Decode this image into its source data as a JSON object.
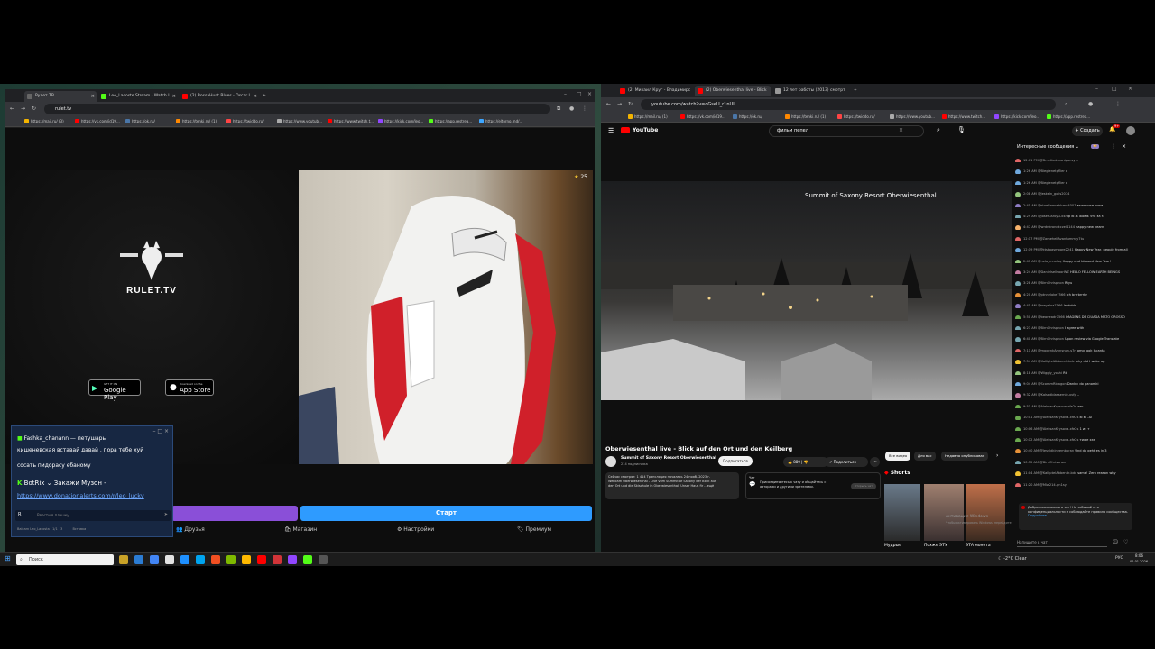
{
  "left_browser": {
    "tabs": [
      {
        "label": "Рулет ТВ",
        "active": true,
        "color": "#666"
      },
      {
        "label": "Leo_Lacostе Stream - Watch Li",
        "active": false,
        "color": "#53fc18"
      },
      {
        "label": "(2) BossaHunt Blues - Oscar I",
        "active": false,
        "color": "#ff0000"
      }
    ],
    "url": "rulet.tv",
    "bookmarks": [
      "https://mail.ru/ (3)",
      "https://vk.com/id19...",
      "https://ok.ru/",
      "https://tenki.ru/ (1)",
      "https://twiddo.ru/",
      "https://www.youtub...",
      "https://www.twitch.t...",
      "https://kick.com/leo...",
      "https://app.restrea...",
      "https://eltorno.md/..."
    ],
    "logo_text": "RULET.TV",
    "store_google": "Google Play",
    "store_google_small": "GET IT ON",
    "store_apple": "App Store",
    "store_apple_small": "Download on the",
    "video_badge": "25",
    "purple_input_placeholder": "",
    "start_button": "Старт",
    "bottom_nav": [
      "Друзья",
      "Магазин",
      "Настройки",
      "Премиум"
    ]
  },
  "chat_overlay": {
    "line1": "Fashka_chanann — петушары",
    "line2": "кишеневская вставай давай . пора тебе хуй",
    "line3": "сосать пидорасу ебаному",
    "bot_name": "BotRix",
    "bot_msg": "Закажи Музон -",
    "bot_link": "https://www.donationalerts.com/r/leo_lucky",
    "input_placeholder": "Ввести в плашку",
    "footer_user": "Balcarn Leo_Lacosta",
    "footer_count": "1/1",
    "footer_viewers": "3",
    "footer_right": "Вставка"
  },
  "right_browser": {
    "tabs": [
      {
        "label": "(2) Михаил Круг - Владимирс",
        "active": false,
        "color": "#ff0000"
      },
      {
        "label": "(2) Oberwiesenthal live - Blick",
        "active": true,
        "color": "#ff0000"
      },
      {
        "label": "12 лет работы (2013) смотрт",
        "active": false,
        "color": "#999"
      }
    ],
    "url": "youtube.com/watch?v=oGseU_r1nUI",
    "bookmarks": [
      "https://mail.ru/ (1)",
      "https://vk.com/id19...",
      "https://ok.ru/",
      "https://tenki.ru/ (1)",
      "https://twiddo.ru/",
      "https://www.youtub...",
      "https://www.twitch...",
      "https://kick.com/leo...",
      "https://app.restrea..."
    ],
    "yt_search": "фильм пепел",
    "create_label": "Создать",
    "notif_count": "9+",
    "video_title_overlay": "Summit of Saxony Resort Oberwiesenthal",
    "video_title": "Oberwiesenthal live - Blick auf den Ort und den Keilberg",
    "channel": "Summit of Saxony Resort Oberwiesenthal",
    "subs": "214 подписчика",
    "subscribe": "Подписаться",
    "likes": "889",
    "share": "Поделиться",
    "chips": [
      "Все видео",
      "Для вас",
      "Недавно опубликован"
    ],
    "desc_line1": "Сейчас смотрят: 1 414  Трансляция началась 24 нояб. 2023 г.",
    "desc_line2": "Webcam Oberwiesenthal - Live vom Summit of Saxony der Blick auf",
    "desc_line3": "den Ort und die Skischule in Oberwiesenthal. Unser Haus fir ...ещё",
    "chat_box_title": "Чат",
    "chat_box_text1": "Присоединяйтесь к чату и общайтесь с",
    "chat_box_text2": "авторами и другими зрителями.",
    "chat_box_btn": "Открыть чат",
    "shorts_label": "Shorts",
    "shorts": [
      "Мудрые",
      "Похже ЭТУ",
      "ЭТА монета"
    ],
    "windows_watermark1": "Активация Windows",
    "windows_watermark2": "Чтобы активировать Windows, перейдите в раздел \"Параметры\"."
  },
  "yt_chat": {
    "header": "Интересные сообщения",
    "lines": [
      {
        "time": "12:01 PM",
        "name": "@DmetLakmonipansy",
        "msg": "..",
        "color": "#e06666"
      },
      {
        "time": "1:26 AM",
        "name": "@Bieglenetpflier",
        "msg": "x",
        "color": "#6fa8dc"
      },
      {
        "time": "1:26 AM",
        "name": "@Bieglenetpflier",
        "msg": "x",
        "color": "#6fa8dc"
      },
      {
        "time": "2:08 AM",
        "name": "@Jeskeln_golis2074",
        "msg": "",
        "color": "#93c47d"
      },
      {
        "time": "2:45 AM",
        "name": "@stoeBarmehhmu4007",
        "msg": "включите пики",
        "color": "#8e7cc3"
      },
      {
        "time": "4:29 AM",
        "name": "@JosefGsroyu-x4r",
        "msg": "ф ю ж жовж что за з",
        "color": "#76a5af"
      },
      {
        "time": "4:47 AM",
        "name": "@wrdnkrondkczel4144",
        "msg": "happy new yearrr",
        "color": "#f6b26b"
      },
      {
        "time": "12:17 PM",
        "name": "@ZameheliAvantumm-y7tu",
        "msg": "",
        "color": "#e06666"
      },
      {
        "time": "12:19 PM",
        "name": "@ktskoasmoore2241",
        "msg": "Happy New Year, people from all over world",
        "color": "#6fa8dc"
      },
      {
        "time": "2:47 AM",
        "name": "@nela_mrwlaq",
        "msg": "Happy and blessed New Year!",
        "color": "#93c47d"
      },
      {
        "time": "3:24 AM",
        "name": "@DanielsellsoorWZ",
        "msg": "HELLO FELLOW EARTH BEINGS",
        "color": "#c27ba0"
      },
      {
        "time": "3:28 AM",
        "name": "@BirnChrispnon",
        "msg": "Rtyu",
        "color": "#76a5af"
      },
      {
        "time": "4:20 AM",
        "name": "@ptnneloke7566",
        "msg": "ich brrrbrrrbr",
        "color": "#e69138"
      },
      {
        "time": "4:45 AM",
        "name": "@weyeloa7566",
        "msg": "la dolda",
        "color": "#8e7cc3"
      },
      {
        "time": "5:50 AM",
        "name": "@beoneadr7566",
        "msg": "IMAGENS DE CIUADA MATO GROSSO",
        "color": "#6aa84f"
      },
      {
        "time": "6:23 AM",
        "name": "@BirnChrispnon",
        "msg": "I agree with",
        "color": "#76a5af"
      },
      {
        "time": "6:40 AM",
        "name": "@BirnChrispnon",
        "msg": "Upon review via Google Translate",
        "color": "#76a5af"
      },
      {
        "time": "7:11 AM",
        "name": "@mogenkAmnsnon-s7n",
        "msg": "omg look Iscanta",
        "color": "#e06666"
      },
      {
        "time": "7:54 AM",
        "name": "@KalliptelAbbendr-bdc",
        "msg": "why did I wake up",
        "color": "#f1c232"
      },
      {
        "time": "8:18 AM",
        "name": "@Wiggly_yoshi",
        "msg": "Rt",
        "color": "#93c47d"
      },
      {
        "time": "9:04 AM",
        "name": "@ScommRbiagon",
        "msg": "Dankic do panomki",
        "color": "#6fa8dc"
      },
      {
        "time": "9:32 AM",
        "name": "@Kalsedblassernie-xvfp",
        "msg": "..",
        "color": "#c27ba0"
      },
      {
        "time": "9:51 AM",
        "name": "@AleksanKrysova-xfe2s",
        "msg": "хес",
        "color": "#6aa84f"
      },
      {
        "time": "10:01 AM",
        "name": "@AleksanKrysova-xfe2s",
        "msg": "ю ю ..ы",
        "color": "#6aa84f"
      },
      {
        "time": "10:06 AM",
        "name": "@AleksanKrysova-xfe2s",
        "msg": "1 из т",
        "color": "#6aa84f"
      },
      {
        "time": "10:12 AM",
        "name": "@AleksanKrysova-xfe2s",
        "msg": "тиже хээ",
        "color": "#6aa84f"
      },
      {
        "time": "10:40 AM",
        "name": "@Jesyldkineembpran",
        "msg": "Und da geht es in 3",
        "color": "#e69138"
      },
      {
        "time": "10:52 AM",
        "name": "@BirnChrispnon",
        "msg": "",
        "color": "#76a5af"
      },
      {
        "time": "11:04 AM",
        "name": "@KalliptelAbbendr-bdc",
        "msg": "same! Zero reason why",
        "color": "#f1c232"
      },
      {
        "time": "11:20 AM",
        "name": "@Mlw214-gn1sy",
        "msg": "",
        "color": "#e06666"
      }
    ],
    "welcome": "Добро пожаловать в чат! Не забывайте о конфиденциальности и соблюдайте правила сообщества.",
    "more": "Подробнее",
    "input_placeholder": "Напишите в чат"
  },
  "taskbar": {
    "search": "Поиск",
    "weather": "-2°C  Clear",
    "lang": "РУС",
    "time": "8:06",
    "date": "02.01.2026"
  }
}
